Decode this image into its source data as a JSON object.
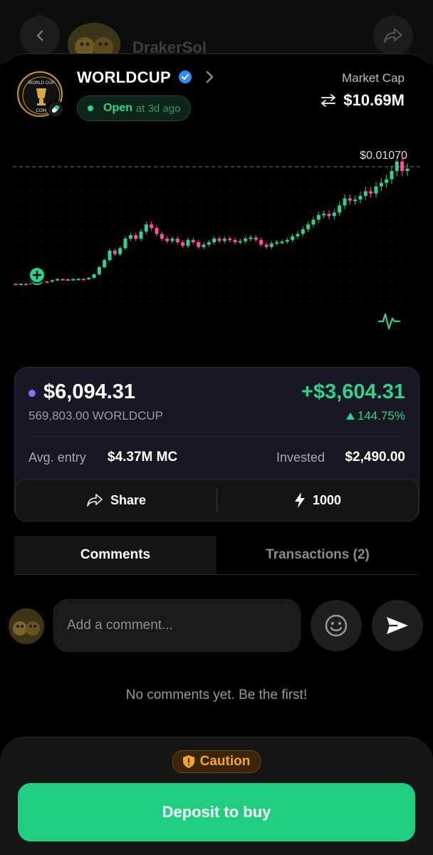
{
  "header": {
    "username": "DrakerSol"
  },
  "token": {
    "name": "WORLDCUP",
    "status": "Open",
    "opened": "at 3d ago",
    "market_cap_label": "Market Cap",
    "market_cap_value": "$10.69M",
    "logo_text_top": "WORLD CUP",
    "logo_text_bottom": "COIN"
  },
  "chart_data": {
    "type": "candlestick",
    "last_price_label": "$0.01070",
    "colors": {
      "up": "#2bd48a",
      "down": "#ff4f9a"
    },
    "candles": [
      [
        0.0012,
        0.00118
      ],
      [
        0.00118,
        0.0012
      ],
      [
        0.0012,
        0.00119
      ],
      [
        0.00119,
        0.00125
      ],
      [
        0.00125,
        0.0013
      ],
      [
        0.0013,
        0.0014
      ],
      [
        0.0014,
        0.00138
      ],
      [
        0.00138,
        0.0015
      ],
      [
        0.0015,
        0.0016
      ],
      [
        0.0016,
        0.00158
      ],
      [
        0.00158,
        0.00157
      ],
      [
        0.00157,
        0.0016
      ],
      [
        0.0016,
        0.00162
      ],
      [
        0.00162,
        0.0016
      ],
      [
        0.0016,
        0.0017
      ],
      [
        0.0017,
        0.002
      ],
      [
        0.002,
        0.0026
      ],
      [
        0.0026,
        0.0032
      ],
      [
        0.0032,
        0.004
      ],
      [
        0.004,
        0.0037
      ],
      [
        0.0037,
        0.0042
      ],
      [
        0.0042,
        0.005
      ],
      [
        0.005,
        0.0053
      ],
      [
        0.0053,
        0.005
      ],
      [
        0.005,
        0.0056
      ],
      [
        0.0056,
        0.0062
      ],
      [
        0.0062,
        0.0059
      ],
      [
        0.0059,
        0.0054
      ],
      [
        0.0054,
        0.005
      ],
      [
        0.005,
        0.0048
      ],
      [
        0.0048,
        0.005
      ],
      [
        0.005,
        0.0047
      ],
      [
        0.0047,
        0.0044
      ],
      [
        0.0044,
        0.0049
      ],
      [
        0.0049,
        0.0047
      ],
      [
        0.0047,
        0.0043
      ],
      [
        0.0043,
        0.0045
      ],
      [
        0.0045,
        0.0047
      ],
      [
        0.0047,
        0.005
      ],
      [
        0.005,
        0.0048
      ],
      [
        0.0048,
        0.005
      ],
      [
        0.005,
        0.0049
      ],
      [
        0.0049,
        0.0047
      ],
      [
        0.0047,
        0.0048
      ],
      [
        0.0048,
        0.005
      ],
      [
        0.005,
        0.0051
      ],
      [
        0.0051,
        0.0049
      ],
      [
        0.0049,
        0.0045
      ],
      [
        0.0045,
        0.0043
      ],
      [
        0.0043,
        0.0046
      ],
      [
        0.0046,
        0.0047
      ],
      [
        0.0047,
        0.00475
      ],
      [
        0.00475,
        0.0049
      ],
      [
        0.0049,
        0.0052
      ],
      [
        0.0052,
        0.0054
      ],
      [
        0.0054,
        0.0058
      ],
      [
        0.0058,
        0.0062
      ],
      [
        0.0062,
        0.0066
      ],
      [
        0.0066,
        0.007
      ],
      [
        0.007,
        0.0071
      ],
      [
        0.0071,
        0.0069
      ],
      [
        0.0069,
        0.0072
      ],
      [
        0.0072,
        0.0078
      ],
      [
        0.0078,
        0.0084
      ],
      [
        0.0084,
        0.0082
      ],
      [
        0.0082,
        0.0083
      ],
      [
        0.0083,
        0.0086
      ],
      [
        0.0086,
        0.009
      ],
      [
        0.009,
        0.0088
      ],
      [
        0.0088,
        0.0094
      ],
      [
        0.0094,
        0.0097
      ],
      [
        0.0097,
        0.01
      ],
      [
        0.01,
        0.0107
      ],
      [
        0.0107,
        0.0115
      ],
      [
        0.0115,
        0.0107
      ],
      [
        0.0107,
        0.0109
      ]
    ]
  },
  "position": {
    "value": "$6,094.31",
    "quantity": "569,803.00 WORLDCUP",
    "pnl": "+$3,604.31",
    "pnl_pct": "144.75%",
    "avg_entry_label": "Avg. entry",
    "avg_entry_value": "$4.37M MC",
    "invested_label": "Invested",
    "invested_value": "$2,490.00",
    "share_label": "Share",
    "boost_value": "1000"
  },
  "tabs": {
    "comments": "Comments",
    "transactions": "Transactions (2)"
  },
  "comments": {
    "placeholder": "Add a comment...",
    "empty": "No comments yet. Be the first!"
  },
  "footer": {
    "caution": "Caution",
    "deposit": "Deposit to buy"
  },
  "colors": {
    "accent_green": "#1fcf7f",
    "pink": "#ff4f9a",
    "purple": "#8b6cf6",
    "caution_orange": "#f5a623"
  }
}
